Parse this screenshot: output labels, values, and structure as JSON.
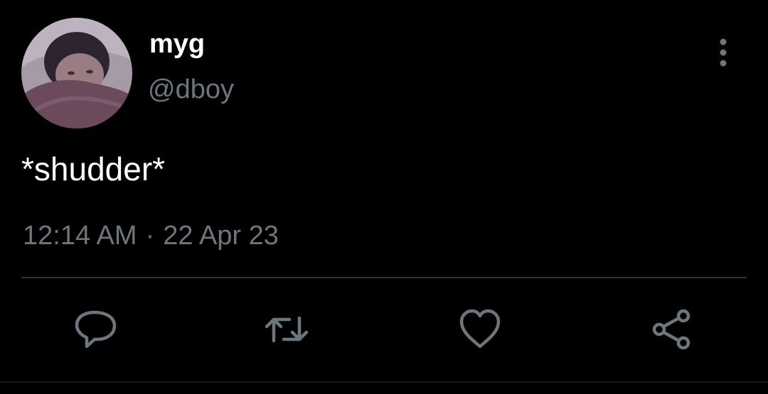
{
  "tweet": {
    "author": {
      "display_name": "myg",
      "handle": "@dboy",
      "avatar_icon": "profile-photo"
    },
    "text": "*shudder*",
    "time": "12:14 AM",
    "separator": "·",
    "date": "22 Apr 23",
    "more_icon": "more-vertical-icon"
  },
  "actions": [
    {
      "name": "reply",
      "icon": "reply-icon"
    },
    {
      "name": "retweet",
      "icon": "retweet-icon"
    },
    {
      "name": "like",
      "icon": "heart-icon"
    },
    {
      "name": "share",
      "icon": "share-icon"
    }
  ],
  "colors": {
    "background": "#000000",
    "primary_text": "#ffffff",
    "secondary_text": "#6e767d",
    "divider": "#2f3336"
  }
}
